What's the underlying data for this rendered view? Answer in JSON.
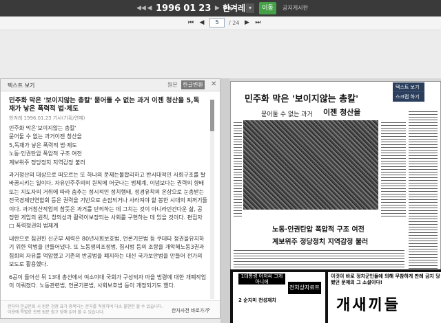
{
  "topbar": {
    "prev_year": "◀◀",
    "prev": "◀",
    "year": "1996",
    "month": "01",
    "day": "23",
    "next": "▶",
    "next_year": "▶▶",
    "paper": "한겨레",
    "dropdown": "▾",
    "go": "이동",
    "notice": "공지게시판"
  },
  "pager": {
    "first": "⏮",
    "prev": "◀",
    "current": "5",
    "total": "/ 24",
    "next": "▶",
    "last": "⏭"
  },
  "panel": {
    "header": "텍스트 보기",
    "original": "원본",
    "convert": "한글변환",
    "close": "✕",
    "title": "민주화 막은 '보이지않는 총칼' 묻어둘 수 없는 과거 이젠 청산을 5,독재가 낳은 폭력적 법·제도",
    "meta": "한겨레 1996.01.23 기사(기획/연재)",
    "body": [
      "민주화 막은'보이지않는 총칼'\n묻어둘 수 없는 과거이젠 청산을\n5,독재가 낳은 폭력적 법·제도\n노동·인권탄압 폭압적 구조 여전\n계보위주 정당정치 지역감정 불러",
      "과거청산의 대상으로 떠오르는 또 하나의 문제는불합리하고 반시대적인 사회구조를 탈바꿈시키는 일이다. 자유민주주의의 원칙에 어긋나는 법체계, 이념보다는 권력의 향배 또는 지도자의 거취에 따라 춤추는 정시적인 정치행태, 정경유착의 온상으로 눈총받는 전국경제인연합회 등은 권력을 기반으로 손잡되거나 사라져야 할 봉한 시대의 찌꺼기들이다. 과거청산작업의 참뜻은 과거를 단죄하는 데 그치는 것이 아니라민간다운 삶, 공정한 게임의 원칙, 창의성과 활력이보장되는 사회를 구현하는 데 있을 것이다. 편집자\n□ 폭력정권의 법제계",
      "내란으로 집권한 신군부 세력은 80년사회보호법, 언론기본법 등 쿠데타 정권을유지하기 위한 악법을 만들어냈다. 또 노동쟁의조정법, 집시법 등의 조항을 개악해노동3권과 집회의 자유를 억압했고 기존의 반공법을 폐지하는 대신 국가보안법을 만들어 전가의 보도로 활용했다.",
      "6공이 들어선 뒤 13대 총선에서 여소야대 국회가 구성되자 마을 법령에 대한 개폐작업이 이뤄졌다. 노동관련법, 언론기본법, 사회보호법 등이 개정되기도 했다."
    ],
    "footer_note": "한자와 한글문화 시 원본 검정 표기·중복되는 문자를 적용하여 다소 불편한 할 수 있습니다. 이용에 특별한 관련 원문 참고 당해 읽어 볼 수 있습니다.",
    "footer_link": "한자사전 바로가기",
    "footer_arrow": "›"
  },
  "newspaper": {
    "headline": "민주화 막은 '보이지않는 총칼'",
    "sub1": "묻어둘 수 없는 과거",
    "sub2": "이젠 청산을",
    "caption1": "노동·인권탄압 폭압적 구조 여전",
    "caption2": "계보위주 정당정치 지역감정 불러"
  },
  "right_menu": {
    "item1": "텍스트 보기",
    "item2": "스크랩 하기"
  },
  "ads": {
    "l1": "1대통령 아저씨 그게 아니에",
    "l2": "전처상자료트",
    "l3": "2 순지미 천성재치",
    "r1": "이것이 바로 정치군인들에 의해 무참하게 판례 금지 당했던 문제의 그 소설이다!",
    "r2": "개새끼들"
  }
}
